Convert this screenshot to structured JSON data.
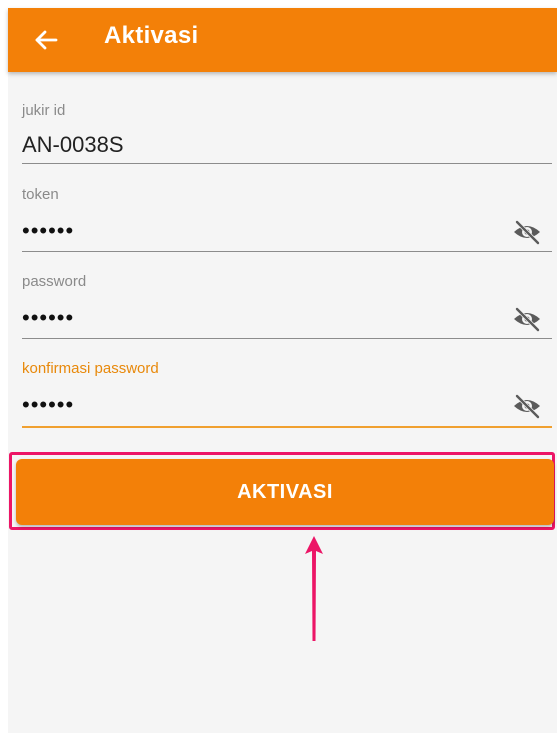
{
  "appbar": {
    "title": "Aktivasi",
    "back_icon": "arrow-left-icon",
    "color": "#f38008"
  },
  "form": {
    "jukir_id": {
      "label": "jukir id",
      "value": "AN-0038S"
    },
    "token": {
      "label": "token",
      "value": "••••••",
      "toggle_icon": "eye-off-icon"
    },
    "password": {
      "label": "password",
      "value": "••••••",
      "toggle_icon": "eye-off-icon"
    },
    "confirm_password": {
      "label": "konfirmasi password",
      "value": "••••••",
      "toggle_icon": "eye-off-icon",
      "focused": true
    }
  },
  "submit_button": {
    "label": "AKTIVASI",
    "color": "#f38008"
  },
  "annotation": {
    "highlight_color": "#ec1566",
    "arrow_icon": "arrow-up-icon"
  }
}
